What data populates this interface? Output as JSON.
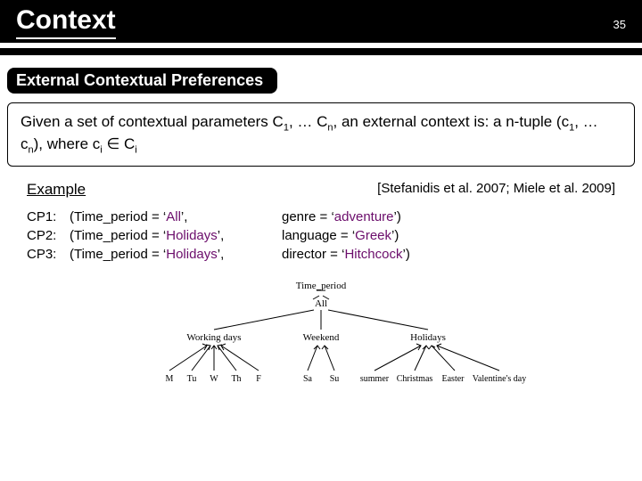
{
  "header": {
    "title": "Context",
    "page": "35"
  },
  "section_title": "External Contextual Preferences",
  "definition": {
    "prefix": "Given a set of contextual parameters C",
    "mid1": ", … C",
    "mid2": ", an external context is: a n-tuple (c",
    "mid3": ", … c",
    "mid4": "), where c",
    "elem": " ∈ C",
    "sub1": "1",
    "subn": "n",
    "subi": "i"
  },
  "example_label": "Example",
  "citation": "[Stefanidis et al. 2007; Miele et al. 2009]",
  "cp": [
    {
      "id": "CP1:",
      "a": "(Time_period = ‘",
      "va": "All",
      "b": "’,",
      "c": "genre = ‘",
      "vc": "adventure",
      "d": "’)"
    },
    {
      "id": "CP2:",
      "a": "(Time_period = ‘",
      "va": "Holidays",
      "b": "’,",
      "c": "language = ‘",
      "vc": "Greek",
      "d": "’)"
    },
    {
      "id": "CP3:",
      "a": "(Time_period = ‘",
      "va": "Holidays",
      "b": "’,",
      "c": "director = ‘",
      "vc": "Hitchcock",
      "d": "’)"
    }
  ],
  "tree": {
    "root": "Time_period",
    "top": "All",
    "mids": [
      "Working days",
      "Weekend",
      "Holidays"
    ],
    "leaves_work": [
      "M",
      "Tu",
      "W",
      "Th",
      "F"
    ],
    "leaves_weekend": [
      "Sa",
      "Su"
    ],
    "leaves_holidays": [
      "summer",
      "Christmas",
      "Easter",
      "Valentine's day"
    ]
  }
}
